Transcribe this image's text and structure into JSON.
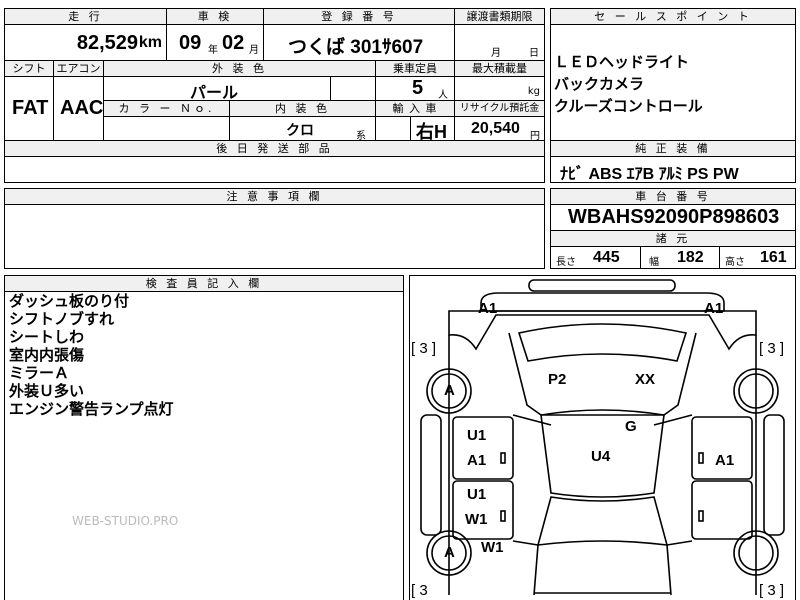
{
  "headers": {
    "mileage": "走 行",
    "inspection": "車 検",
    "registration": "登 録 番 号",
    "transfer_deadline": "譲渡書類期限",
    "sales_point": "セ ー ル ス ポ イ ン ト",
    "shift": "シフト",
    "aircon": "エアコン",
    "exterior_color": "外 装 色",
    "capacity": "乗車定員",
    "max_load": "最大積載量",
    "color_no": "カ ラ ー Ｎｏ.",
    "interior_color": "内 装 色",
    "import": "輸 入 車",
    "recycle": "リサイクル預託金",
    "later_parts": "後 日 発 送 部 品",
    "equipment": "純 正 装 備",
    "notes": "注 意 事 項 欄",
    "chassis_no": "車 台 番 号",
    "specs": "諸 元",
    "inspector": "検 査 員 記 入 欄"
  },
  "values": {
    "mileage": "82,529",
    "mileage_unit": "km",
    "inspection_year": "09",
    "year_unit": "年",
    "inspection_month": "02",
    "month_unit": "月",
    "plate": "つくば 301ｻ607",
    "deadline_month_unit": "月",
    "deadline_day_unit": "日",
    "shift": "FAT",
    "aircon": "AAC",
    "exterior_color": "パール",
    "capacity": "5",
    "capacity_unit": "人",
    "load_unit": "kg",
    "interior_color": "クロ",
    "interior_suffix": "系",
    "import": "右H",
    "recycle": "20,540",
    "recycle_unit": "円",
    "equipment": "ﾅﾋﾞ ABS ｴｱB ｱﾙﾐ PS PW",
    "chassis_no": "WBAHS92090P898603",
    "length_label": "長さ",
    "length": "445",
    "width_label": "幅",
    "width": "182",
    "height_label": "高さ",
    "height": "161"
  },
  "sales_points": [
    "ＬＥＤヘッドライト",
    "バックカメラ",
    "クルーズコントロール"
  ],
  "remarks": [
    "ダッシュ板のり付",
    "シフトノブすれ",
    "シートしわ",
    "室内内張傷",
    "ミラーＡ",
    "外装Ｕ多い",
    "エンジン警告ランプ点灯"
  ],
  "diagram": {
    "a1_left": "A1",
    "a1_right": "A1",
    "bracket_tl": "[ 3 ]",
    "bracket_tr": "[ 3 ]",
    "bracket_bl": "[ 3",
    "bracket_br": "[ 3 ]",
    "wheel_a_top": "A",
    "wheel_a_bottom": "A",
    "p2": "P2",
    "xx": "XX",
    "g": "G",
    "u4": "U4",
    "door_fl_1": "U1",
    "door_fl_2": "A1",
    "door_fr": "A1",
    "door_rl_1": "U1",
    "door_rl_2": "W1",
    "w1_rear": "W1"
  },
  "watermark": "WEB-STUDIO.PRO"
}
